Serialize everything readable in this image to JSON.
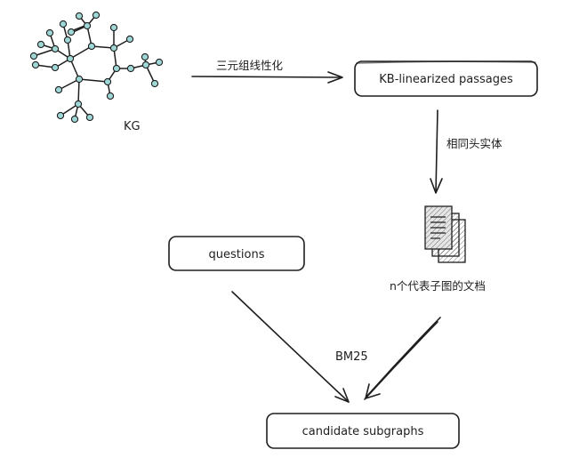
{
  "kg": {
    "label": "KG"
  },
  "edges": {
    "linearize": "三元组线性化",
    "same_head": "相同头实体",
    "bm25": "BM25"
  },
  "boxes": {
    "passages": "KB-linearized passages",
    "questions": "questions",
    "candidates": "candidate subgraphs"
  },
  "documents": {
    "caption": "n个代表子图的文档"
  },
  "colors": {
    "node_fill": "#9fd6d6",
    "stroke": "#1e1e1e",
    "background": "#ffffff"
  }
}
